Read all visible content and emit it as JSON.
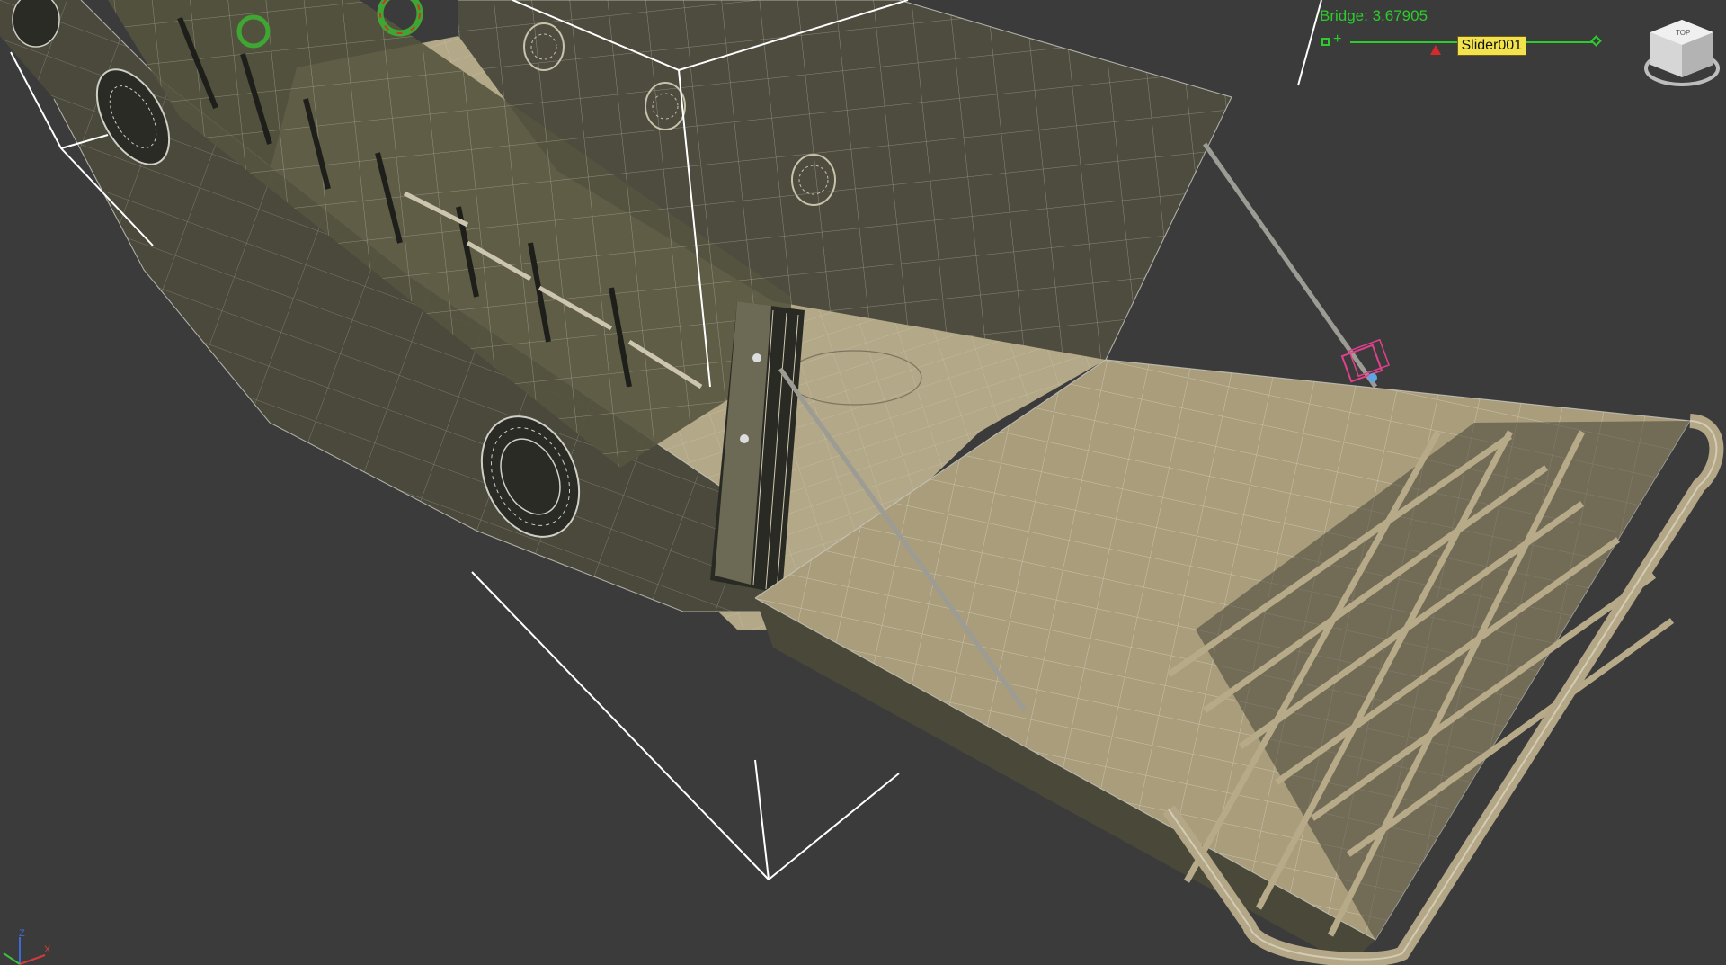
{
  "viewport": {
    "background": "#3b3b3b",
    "hull_color": "#4b4a3d",
    "deck_color": "#b9ad8c",
    "wire_color": "#cfcfc6",
    "hud_color": "#2ccc2c",
    "slider_label_color": "#f2e24d",
    "selection_bracket_color": "#ffffff",
    "helper_color": "#e0408c"
  },
  "parameter_readout": {
    "label": "Bridge: 3.67905"
  },
  "slider": {
    "name": "Slider001",
    "value_fraction": 0.35
  },
  "viewcube": {
    "icon": "viewcube-icon",
    "face_label": "TOP"
  },
  "axis_tripod": {
    "icon": "axis-tripod-icon",
    "z": "Z",
    "x": "X"
  },
  "scene_objects": {
    "hull": "landing-craft-hull",
    "ramp": "bow-ramp-grid",
    "tire": "tire-fender",
    "helper": "point-helper-cube"
  }
}
